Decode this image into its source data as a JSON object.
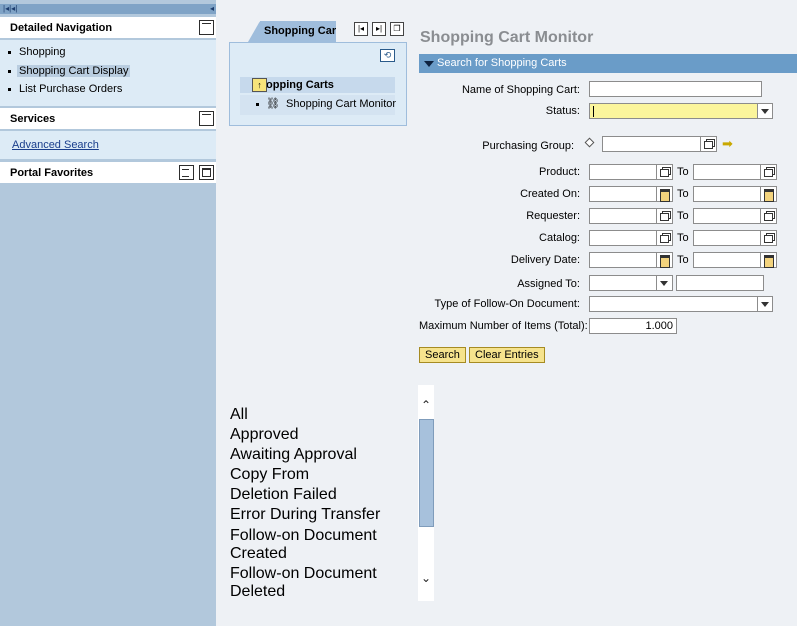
{
  "leftnav": {
    "detailed_navigation": "Detailed Navigation",
    "nav_items": [
      {
        "label": "Shopping"
      },
      {
        "label": "Shopping Cart Display"
      },
      {
        "label": "List Purchase Orders"
      }
    ],
    "services": "Services",
    "advanced_search": "Advanced Search",
    "portal_favorites": "Portal Favorites"
  },
  "worksetmap": {
    "tab_label": "Shopping Car",
    "panel_header": "Shopping Carts",
    "panel_item": "Shopping Cart Monitor",
    "icons": {
      "first": "first-page-icon",
      "last": "last-page-icon",
      "list": "page-list-icon",
      "refresh": "refresh-icon",
      "pin": "pin-icon",
      "binoculars": "binoculars-icon"
    }
  },
  "status_options": [
    "All",
    "Approved",
    "Awaiting Approval",
    "Copy From",
    "Deletion Failed",
    "Error During Transfer",
    "Follow-on Document",
    "Created",
    "Follow-on Document",
    "Deleted"
  ],
  "form": {
    "title": "Shopping Cart Monitor",
    "section": "Search for Shopping Carts",
    "name_label": "Name of Shopping Cart:",
    "name_value": "",
    "status_label": "Status:",
    "status_value": "",
    "purchasing_group_label": "Purchasing Group:",
    "product_label": "Product:",
    "created_on_label": "Created On:",
    "requester_label": "Requester:",
    "catalog_label": "Catalog:",
    "delivery_date_label": "Delivery Date:",
    "to_label": "To",
    "assigned_to_label": "Assigned To:",
    "follow_on_label": "Type of Follow-On Document:",
    "max_items_label": "Maximum Number of Items (Total):",
    "max_items_value": "1.000",
    "search_button": "Search",
    "clear_button": "Clear Entries"
  },
  "colors": {
    "nav_bg": "#b2c8dc",
    "section_bar": "#6a9cc8",
    "button_bg": "#f6e38d",
    "status_field": "#fbf59c"
  }
}
